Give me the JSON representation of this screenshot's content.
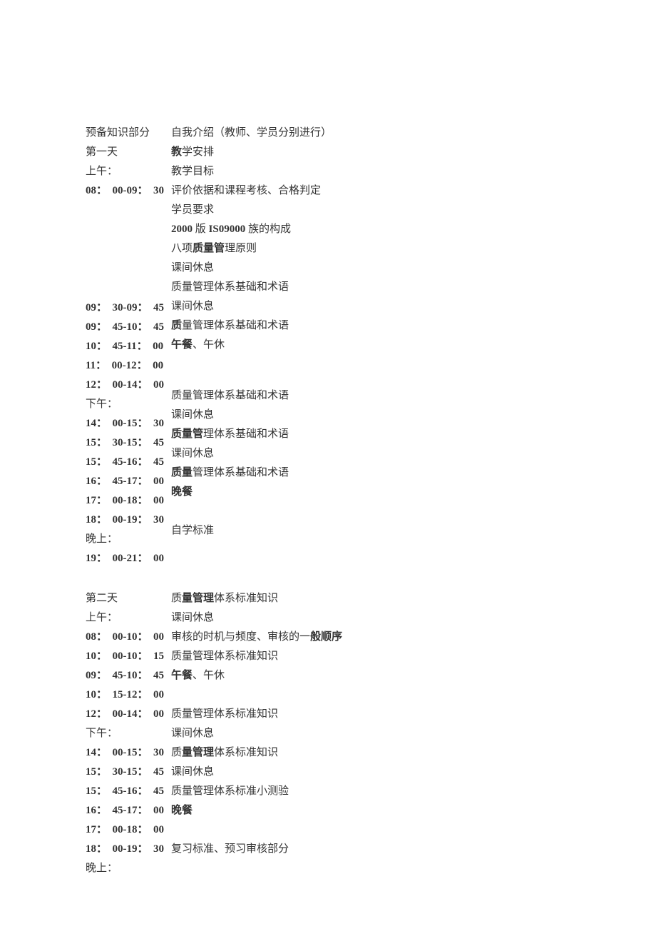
{
  "left1": [
    {
      "text": "预备知识部分"
    },
    {
      "text": "第一天"
    },
    {
      "text": "上午："
    },
    {
      "text": "08：00-09：30",
      "bold": true,
      "time": true
    }
  ],
  "left2": [
    {
      "text": "09：30-09：45",
      "bold": true,
      "time": true
    },
    {
      "text": "09：45-10：45",
      "bold": true,
      "time": true
    },
    {
      "text": "10：45-11：00",
      "bold": true,
      "time": true
    },
    {
      "text": "11：00-12：00",
      "bold": true,
      "time": true
    },
    {
      "text": "12：00-14：00",
      "bold": true,
      "time": true
    },
    {
      "text": "下午："
    },
    {
      "text": "14：00-15：30",
      "bold": true,
      "time": true
    },
    {
      "text": "15：30-15：45",
      "bold": true,
      "time": true
    },
    {
      "text": "15：45-16：45",
      "bold": true,
      "time": true
    },
    {
      "text": "16：45-17：00",
      "bold": true,
      "time": true
    },
    {
      "text": "17：00-18：00",
      "bold": true,
      "time": true
    },
    {
      "text": "18：00-19：30",
      "bold": true,
      "time": true
    },
    {
      "text": "晚上："
    },
    {
      "text": "19：00-21：00",
      "bold": true,
      "time": true
    }
  ],
  "left3": [
    {
      "text": "第二天"
    },
    {
      "text": "上午："
    },
    {
      "text": "08：00-10：00",
      "bold": true,
      "time": true
    },
    {
      "text": "10：00-10：15",
      "bold": true,
      "time": true
    },
    {
      "text": "09：45-10：45",
      "bold": true,
      "time": true
    },
    {
      "text": "10：15-12：00",
      "bold": true,
      "time": true
    },
    {
      "text": "12：00-14：00",
      "bold": true,
      "time": true
    },
    {
      "text": "下午："
    },
    {
      "text": "14：00-15：30",
      "bold": true,
      "time": true
    },
    {
      "text": "15：30-15：45",
      "bold": true,
      "time": true
    },
    {
      "text": "15：45-16：45",
      "bold": true,
      "time": true
    },
    {
      "text": "16：45-17：00",
      "bold": true,
      "time": true
    },
    {
      "text": "17：00-18：00",
      "bold": true,
      "time": true
    },
    {
      "text": "18：00-19：30",
      "bold": true,
      "time": true
    },
    {
      "text": "晚上："
    }
  ],
  "right1": [
    {
      "segments": [
        {
          "t": "自我介绍（教师、学员分别进行）"
        }
      ]
    },
    {
      "segments": [
        {
          "t": "教",
          "b": true
        },
        {
          "t": "学安排"
        }
      ]
    },
    {
      "segments": [
        {
          "t": "教学目标"
        }
      ]
    },
    {
      "segments": [
        {
          "t": "评价依据和课程考核、合格判定"
        }
      ]
    },
    {
      "segments": [
        {
          "t": "学员要求"
        }
      ]
    },
    {
      "segments": [
        {
          "t": "2000",
          "b": true,
          "tm": true
        },
        {
          "t": " 版 "
        },
        {
          "t": "IS09000",
          "b": true,
          "tm": true
        },
        {
          "t": " 族的构成"
        }
      ]
    },
    {
      "segments": [
        {
          "t": "八项"
        },
        {
          "t": "质量管",
          "b": true
        },
        {
          "t": "理原则"
        }
      ]
    },
    {
      "segments": [
        {
          "t": "课间休息"
        }
      ]
    },
    {
      "segments": [
        {
          "t": "质量管理体系基础和术语"
        }
      ]
    },
    {
      "segments": [
        {
          "t": "课间休息"
        }
      ]
    },
    {
      "segments": [
        {
          "t": "质",
          "b": true
        },
        {
          "t": "量管理体系基础和术语"
        }
      ]
    },
    {
      "segments": [
        {
          "t": "午餐",
          "b": true
        },
        {
          "t": "、午休"
        }
      ]
    }
  ],
  "right2": [
    {
      "segments": [
        {
          "t": "质量管理体系基础和术语"
        }
      ]
    },
    {
      "segments": [
        {
          "t": "课间休息"
        }
      ]
    },
    {
      "segments": [
        {
          "t": "质量管",
          "b": true
        },
        {
          "t": "理体系基础和术语"
        }
      ]
    },
    {
      "segments": [
        {
          "t": "课间休息"
        }
      ]
    },
    {
      "segments": [
        {
          "t": "质量",
          "b": true
        },
        {
          "t": "管理体系基础和术语"
        }
      ]
    },
    {
      "segments": [
        {
          "t": "晚餐",
          "b": true
        }
      ]
    }
  ],
  "right3": [
    {
      "segments": [
        {
          "t": "自学标准"
        }
      ]
    }
  ],
  "right4": [
    {
      "segments": [
        {
          "t": "质"
        },
        {
          "t": "量管理",
          "b": true
        },
        {
          "t": "体系标准知识"
        }
      ]
    },
    {
      "segments": [
        {
          "t": "课间休息"
        }
      ]
    },
    {
      "segments": [
        {
          "t": "审核的时机与频度、审核的一"
        },
        {
          "t": "般顺序",
          "b": true
        }
      ]
    },
    {
      "segments": [
        {
          "t": "质量管理体系标准知识"
        }
      ]
    },
    {
      "segments": [
        {
          "t": "午餐",
          "b": true
        },
        {
          "t": "、午休"
        }
      ]
    }
  ],
  "right5": [
    {
      "segments": [
        {
          "t": "质量管理体系标准知识"
        }
      ]
    },
    {
      "segments": [
        {
          "t": "课间休息"
        }
      ]
    },
    {
      "segments": [
        {
          "t": "质"
        },
        {
          "t": "量管理",
          "b": true
        },
        {
          "t": "体系标准知识"
        }
      ]
    },
    {
      "segments": [
        {
          "t": "课间休息"
        }
      ]
    },
    {
      "segments": [
        {
          "t": "质量管理体系标准小测验"
        }
      ]
    },
    {
      "segments": [
        {
          "t": "晚餐",
          "b": true
        }
      ]
    }
  ],
  "right6": [
    {
      "segments": [
        {
          "t": "复习标准、预习审核部分"
        }
      ]
    }
  ]
}
